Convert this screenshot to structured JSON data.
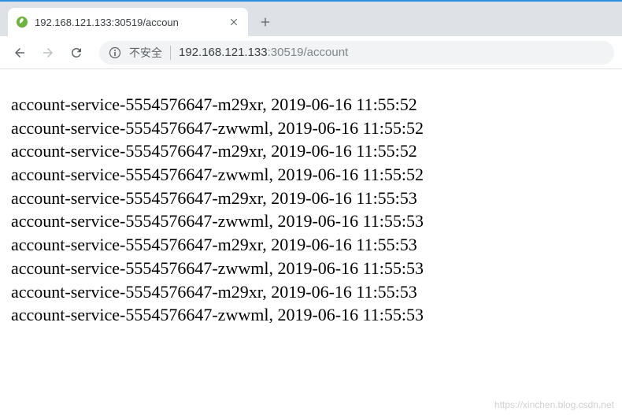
{
  "tab": {
    "title": "192.168.121.133:30519/accoun"
  },
  "addressBar": {
    "securityLabel": "不安全",
    "host": "192.168.121.133",
    "port": ":30519",
    "path": "/account"
  },
  "lines": [
    "account-service-5554576647-m29xr, 2019-06-16 11:55:52",
    "account-service-5554576647-zwwml, 2019-06-16 11:55:52",
    "account-service-5554576647-m29xr, 2019-06-16 11:55:52",
    "account-service-5554576647-zwwml, 2019-06-16 11:55:52",
    "account-service-5554576647-m29xr, 2019-06-16 11:55:53",
    "account-service-5554576647-zwwml, 2019-06-16 11:55:53",
    "account-service-5554576647-m29xr, 2019-06-16 11:55:53",
    "account-service-5554576647-zwwml, 2019-06-16 11:55:53",
    "account-service-5554576647-m29xr, 2019-06-16 11:55:53",
    "account-service-5554576647-zwwml, 2019-06-16 11:55:53"
  ],
  "watermark": "https://xinchen.blog.csdn.net"
}
